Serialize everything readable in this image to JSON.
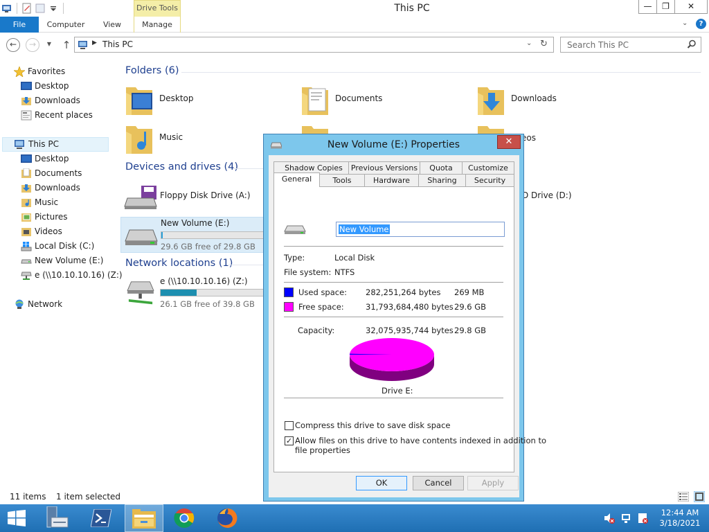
{
  "window": {
    "title": "This PC",
    "context_tab": "Drive Tools",
    "min": "—",
    "max": "❐",
    "close": "✕"
  },
  "ribbon": {
    "tabs": [
      "File",
      "Computer",
      "View",
      "Manage"
    ],
    "help": "?"
  },
  "nav": {
    "address": "This PC",
    "search_placeholder": "Search This PC"
  },
  "sidebar": {
    "favorites": "Favorites",
    "favorites_items": [
      "Desktop",
      "Downloads",
      "Recent places"
    ],
    "this_pc": "This PC",
    "this_pc_items": [
      "Desktop",
      "Documents",
      "Downloads",
      "Music",
      "Pictures",
      "Videos",
      "Local Disk (C:)",
      "New Volume (E:)",
      "e (\\\\10.10.10.16) (Z:)"
    ],
    "network": "Network"
  },
  "main": {
    "folders_header": "Folders (6)",
    "folders": [
      "Desktop",
      "Documents",
      "Downloads",
      "Music"
    ],
    "partial_videos": "eos",
    "devices_header": "Devices and drives (4)",
    "floppy": "Floppy Disk Drive (A:)",
    "dvd_partial": "D Drive (D:)",
    "drive_e": {
      "name": "New Volume (E:)",
      "free": "29.6 GB free of 29.8 GB",
      "used_fraction": 0.01
    },
    "network_header": "Network locations (1)",
    "net_drive": {
      "name": "e (\\\\10.10.10.16) (Z:)",
      "free": "26.1 GB free of 39.8 GB",
      "used_fraction": 0.34
    }
  },
  "status": {
    "items": "11 items",
    "selected": "1 item selected"
  },
  "taskbar": {
    "time": "12:44 AM",
    "date": "3/18/2021"
  },
  "dialog": {
    "title": "New Volume (E:) Properties",
    "close": "✕",
    "tabs_row1": [
      "Shadow Copies",
      "Previous Versions",
      "Quota",
      "Customize"
    ],
    "tabs_row2": [
      "General",
      "Tools",
      "Hardware",
      "Sharing",
      "Security"
    ],
    "volume_name": "New Volume",
    "type_label": "Type:",
    "type_value": "Local Disk",
    "fs_label": "File system:",
    "fs_value": "NTFS",
    "used_label": "Used space:",
    "used_bytes": "282,251,264 bytes",
    "used_human": "269 MB",
    "free_label": "Free space:",
    "free_bytes": "31,793,684,480 bytes",
    "free_human": "29.6 GB",
    "capacity_label": "Capacity:",
    "capacity_bytes": "32,075,935,744 bytes",
    "capacity_human": "29.8 GB",
    "drive_label": "Drive E:",
    "used_color": "#0000ff",
    "free_color": "#ff00ff",
    "used_fraction": 0.0088,
    "compress_label": "Compress this drive to save disk space",
    "compress_checked": false,
    "index_label_1": "Allow files on this drive to have contents indexed in addition to",
    "index_label_2": "file properties",
    "index_checked": true,
    "buttons": {
      "ok": "OK",
      "cancel": "Cancel",
      "apply": "Apply"
    }
  }
}
